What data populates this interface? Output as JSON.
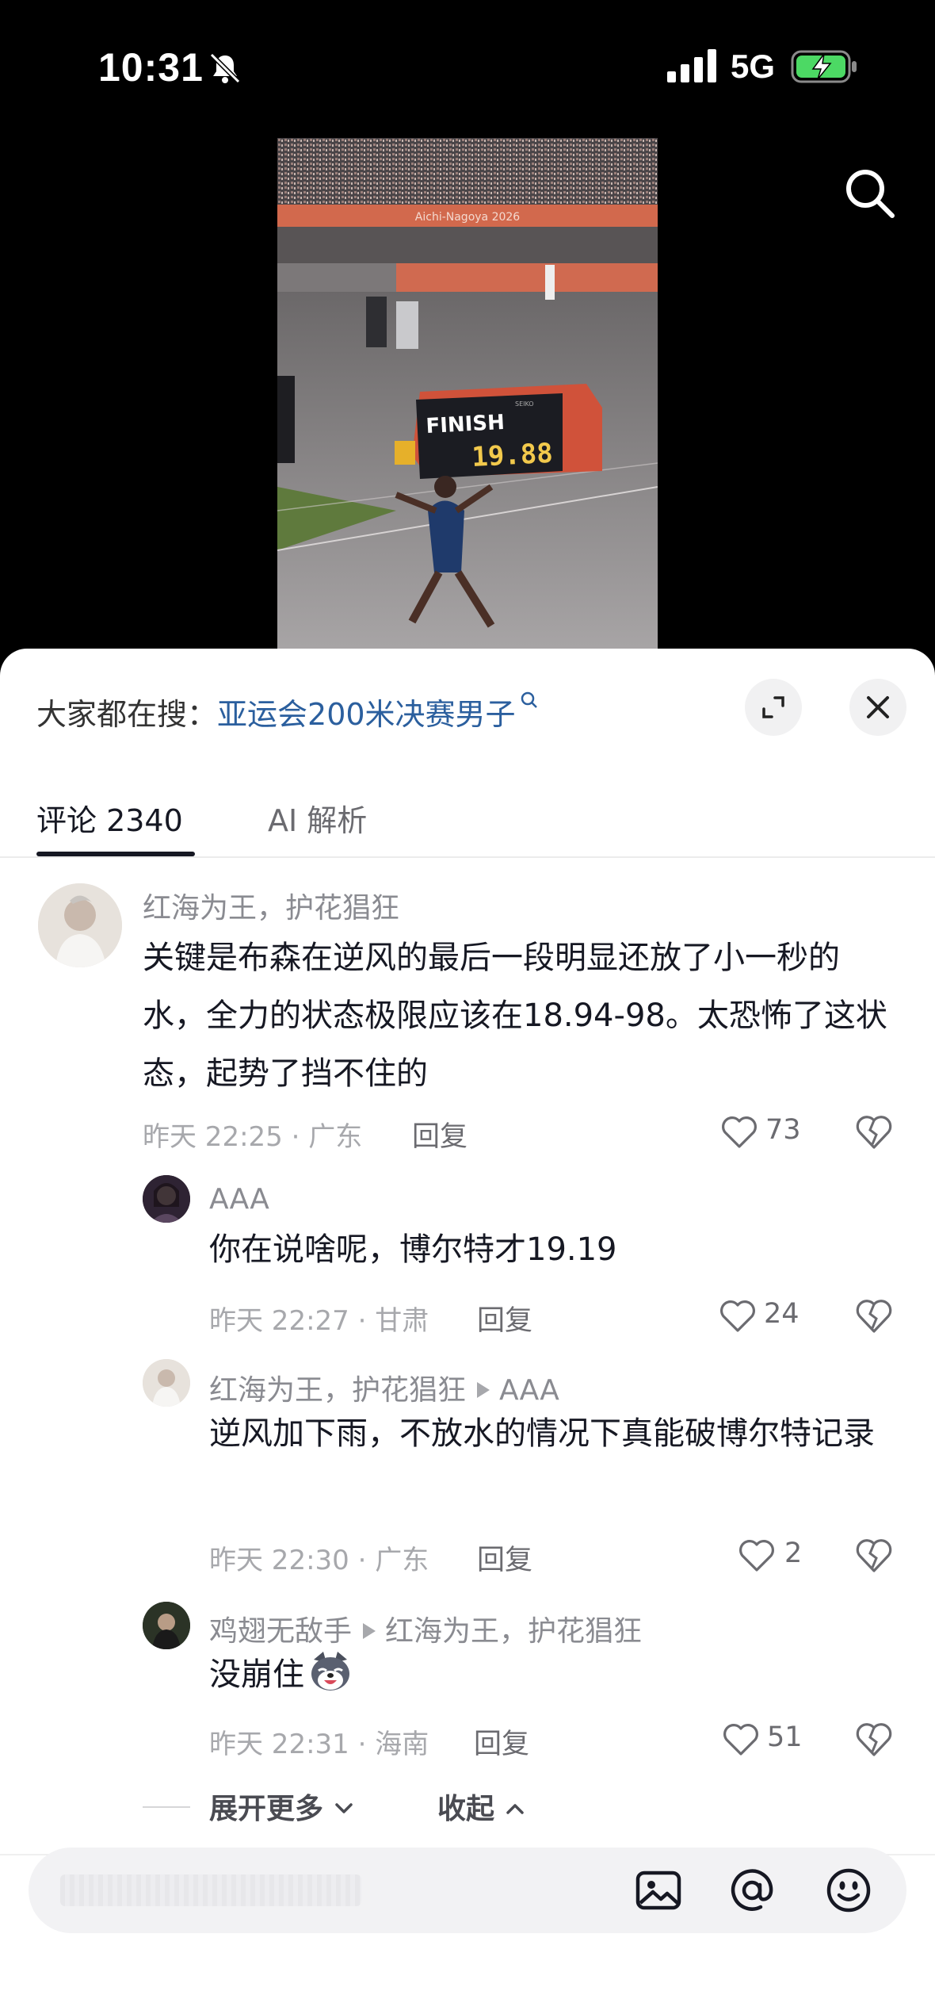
{
  "status_bar": {
    "time": "10:31",
    "network": "5G",
    "icons": [
      "bell-off-icon",
      "signal-icon",
      "battery-charging-icon"
    ]
  },
  "video": {
    "stadium_banner": "Aichi-Nagoya 2026",
    "board_label": "FINISH",
    "board_time": "19.88",
    "board_brand": "SEIKO"
  },
  "header": {
    "trend_prefix": "大家都在搜：",
    "trend_query": "亚运会200米决赛男子"
  },
  "tabs": [
    {
      "label": "评论 2340"
    },
    {
      "label": "AI 解析"
    }
  ],
  "comments": [
    {
      "username": "红海为王，护花猖狂",
      "text": "关键是布森在逆风的最后一段明显还放了小一秒的水，全力的状态极限应该在18.94-98。太恐怖了这状态，起势了挡不住的",
      "meta": "昨天 22:25 · 广东",
      "reply": "回复",
      "likes": "73"
    },
    {
      "username": "AAA",
      "text": "你在说啥呢，博尔特才19.19",
      "meta": "昨天 22:27 · 甘肃",
      "reply": "回复",
      "likes": "24"
    },
    {
      "username": "红海为王，护花猖狂",
      "reply_to": "AAA",
      "text": "逆风加下雨，不放水的情况下真能破博尔特记录",
      "meta": "昨天 22:30 · 广东",
      "reply": "回复",
      "likes": "2"
    },
    {
      "username": "鸡翅无敌手",
      "reply_to": "红海为王，护花猖狂",
      "text": "没崩住",
      "meta": "昨天 22:31 · 海南",
      "reply": "回复",
      "likes": "51"
    }
  ],
  "thread_controls": {
    "expand_more": "展开更多",
    "collapse": "收起"
  },
  "input_bar": {
    "icons": [
      "image-icon",
      "at-icon",
      "emoji-icon"
    ]
  }
}
